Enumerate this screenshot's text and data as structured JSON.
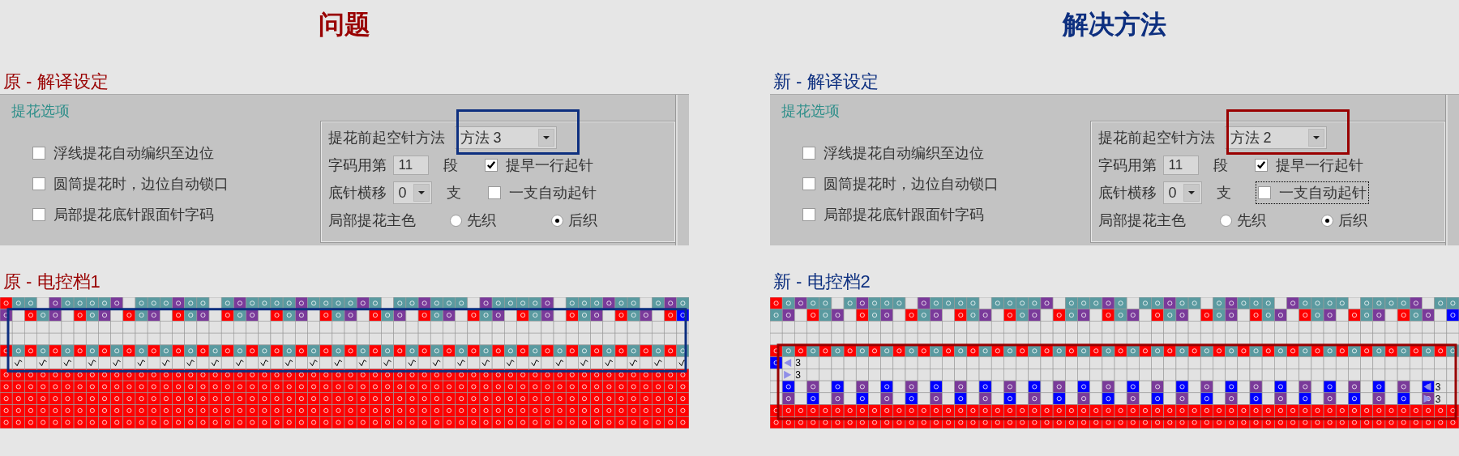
{
  "panels": [
    {
      "heading": "问题",
      "color": "#990000",
      "settings": {
        "title": "原 - 解译设定",
        "group_title": "提花选项",
        "options": [
          {
            "label": "浮线提花自动编织至边位",
            "checked": false
          },
          {
            "label": "圆筒提花时，边位自动锁口",
            "checked": false
          },
          {
            "label": "局部提花底针跟面针字码",
            "checked": false
          }
        ],
        "method": {
          "label": "提花前起空针方法",
          "value": "方法 3",
          "highlight": {
            "color": "#0d2f7f"
          }
        },
        "segment": {
          "label": "字码用第",
          "value": "11",
          "unit": "段"
        },
        "shift": {
          "label": "底针横移",
          "value": "0",
          "unit": "支"
        },
        "checks": [
          {
            "label": "提早一行起针",
            "checked": true,
            "focused": false
          },
          {
            "label": "一支自动起针",
            "checked": false,
            "focused": false
          }
        ],
        "main_color": {
          "label": "局部提花主色",
          "choices": [
            {
              "label": "先织",
              "selected": false
            },
            {
              "label": "后织",
              "selected": true
            }
          ]
        }
      },
      "chart": {
        "title": "原 - 电控档1",
        "kind": "original",
        "highlight": {
          "color": "#0d2f7f"
        }
      }
    },
    {
      "heading": "解决方法",
      "color": "#0d2f7f",
      "settings": {
        "title": "新 - 解译设定",
        "group_title": "提花选项",
        "options": [
          {
            "label": "浮线提花自动编织至边位",
            "checked": false
          },
          {
            "label": "圆筒提花时，边位自动锁口",
            "checked": false
          },
          {
            "label": "局部提花底针跟面针字码",
            "checked": false
          }
        ],
        "method": {
          "label": "提花前起空针方法",
          "value": "方法 2",
          "highlight": {
            "color": "#990000"
          }
        },
        "segment": {
          "label": "字码用第",
          "value": "11",
          "unit": "段"
        },
        "shift": {
          "label": "底针横移",
          "value": "0",
          "unit": "支"
        },
        "checks": [
          {
            "label": "提早一行起针",
            "checked": true,
            "focused": false
          },
          {
            "label": "一支自动起针",
            "checked": false,
            "focused": true
          }
        ],
        "main_color": {
          "label": "局部提花主色",
          "choices": [
            {
              "label": "先织",
              "selected": false
            },
            {
              "label": "后织",
              "selected": true
            }
          ]
        }
      },
      "chart": {
        "title": "新 - 电控档2",
        "kind": "revised",
        "highlight": {
          "color": "#990000"
        },
        "markers": [
          "3",
          "3",
          "3",
          "3"
        ]
      }
    }
  ]
}
